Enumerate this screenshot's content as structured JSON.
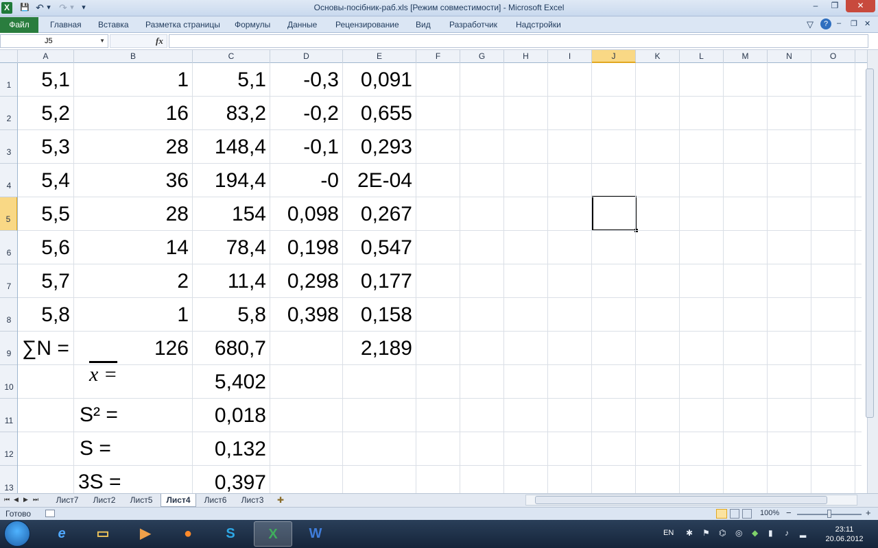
{
  "window": {
    "title": "Основы-посібник-раб.xls  [Режим совместимости]  -  Microsoft Excel",
    "minimize": "–",
    "maximize": "❐",
    "close": "✕"
  },
  "quick_access": {
    "app_icon": "X",
    "save": "💾",
    "undo": "↶",
    "undo_dd": "▾",
    "redo": "↷",
    "redo_dd": "▾",
    "customize": "▾"
  },
  "ribbon": {
    "file_tab": "Файл",
    "tabs": [
      "Главная",
      "Вставка",
      "Разметка страницы",
      "Формулы",
      "Данные",
      "Рецензирование",
      "Вид",
      "Разработчик",
      "Надстройки"
    ],
    "help": "?",
    "minimize_ribbon": "▽"
  },
  "formula_bar": {
    "name_box": "J5",
    "fx": "fx",
    "formula": ""
  },
  "columns": [
    "A",
    "B",
    "C",
    "D",
    "E",
    "F",
    "G",
    "H",
    "I",
    "J",
    "K",
    "L",
    "M",
    "N",
    "O"
  ],
  "selected_column": "J",
  "rows": [
    "1",
    "2",
    "3",
    "4",
    "5",
    "6",
    "7",
    "8",
    "9",
    "10",
    "11",
    "12",
    "13"
  ],
  "selected_row": "5",
  "table": {
    "A": [
      "5,1",
      "5,2",
      "5,3",
      "5,4",
      "5,5",
      "5,6",
      "5,7",
      "5,8"
    ],
    "B": [
      "1",
      "16",
      "28",
      "36",
      "28",
      "14",
      "2",
      "1",
      "126"
    ],
    "C": [
      "5,1",
      "83,2",
      "148,4",
      "194,4",
      "154",
      "78,4",
      "11,4",
      "5,8",
      "680,7",
      "5,402",
      "0,018",
      "0,132",
      "0,397"
    ],
    "D": [
      "-0,3",
      "-0,2",
      "-0,1",
      "-0",
      "0,098",
      "0,198",
      "0,298",
      "0,398"
    ],
    "E": [
      "0,091",
      "0,655",
      "0,293",
      "2E-04",
      "0,267",
      "0,547",
      "0,177",
      "0,158",
      "2,189"
    ]
  },
  "formulas": {
    "sum_n": "∑N =",
    "mean": "x =",
    "variance": "S² =",
    "std": "S =",
    "three_s": "3S ="
  },
  "sheets": {
    "tabs": [
      "Лист7",
      "Лист2",
      "Лист5",
      "Лист4",
      "Лист6",
      "Лист3"
    ],
    "active": "Лист4",
    "nav": [
      "⏮",
      "◀",
      "▶",
      "⏭"
    ],
    "insert_icon": "✚"
  },
  "status": {
    "ready": "Готово",
    "zoom": "100%",
    "zoom_minus": "−",
    "zoom_plus": "+"
  },
  "taskbar": {
    "lang": "EN",
    "time": "23:11",
    "date": "20.06.2012",
    "apps": [
      "IE",
      "Explorer",
      "Media",
      "Firefox",
      "Skype",
      "Excel",
      "Word"
    ]
  },
  "colors": {
    "accent": "#2a7d3e",
    "selection": "#f9d885",
    "taskbar": "#1b2d45"
  }
}
